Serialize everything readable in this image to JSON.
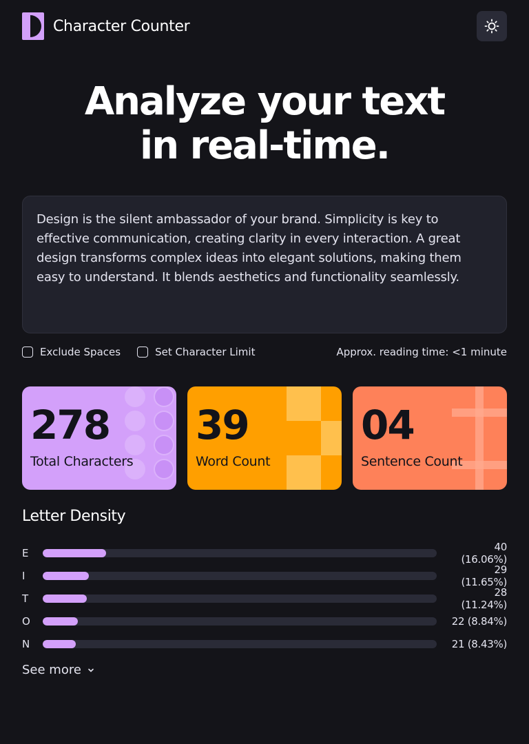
{
  "header": {
    "app_name": "Character Counter",
    "logo_icon": "half-circle-logo",
    "theme_icon": "sun-icon"
  },
  "hero": {
    "line1": "Analyze your text",
    "line2": "in real-time."
  },
  "editor": {
    "value": "Design is the silent ambassador of your brand. Simplicity is key to effective communication, creating clarity in every interaction. A great design transforms complex ideas into elegant solutions, making them easy to understand. It blends aesthetics and functionality seamlessly."
  },
  "options": {
    "exclude_spaces": {
      "label": "Exclude Spaces",
      "checked": false
    },
    "char_limit": {
      "label": "Set Character Limit",
      "checked": false
    },
    "reading_time": "Approx. reading time: <1 minute"
  },
  "stats": [
    {
      "value": "278",
      "label": "Total Characters",
      "color": "#d3a0fa"
    },
    {
      "value": "39",
      "label": "Word Count",
      "color": "#ff9f00"
    },
    {
      "value": "04",
      "label": "Sentence Count",
      "color": "#fe8159"
    }
  ],
  "density": {
    "title": "Letter Density",
    "items": [
      {
        "letter": "E",
        "count": "40 (16.06%)",
        "percent": 16.06
      },
      {
        "letter": "I",
        "count": "29 (11.65%)",
        "percent": 11.65
      },
      {
        "letter": "T",
        "count": "28 (11.24%)",
        "percent": 11.24
      },
      {
        "letter": "O",
        "count": "22 (8.84%)",
        "percent": 8.84
      },
      {
        "letter": "N",
        "count": "21 (8.43%)",
        "percent": 8.43
      }
    ],
    "see_more": "See more",
    "see_more_icon": "chevron-down-icon"
  },
  "colors": {
    "background": "#141419",
    "accent_purple": "#d3a0fa",
    "accent_orange": "#ff9f00",
    "accent_coral": "#fe8159"
  }
}
